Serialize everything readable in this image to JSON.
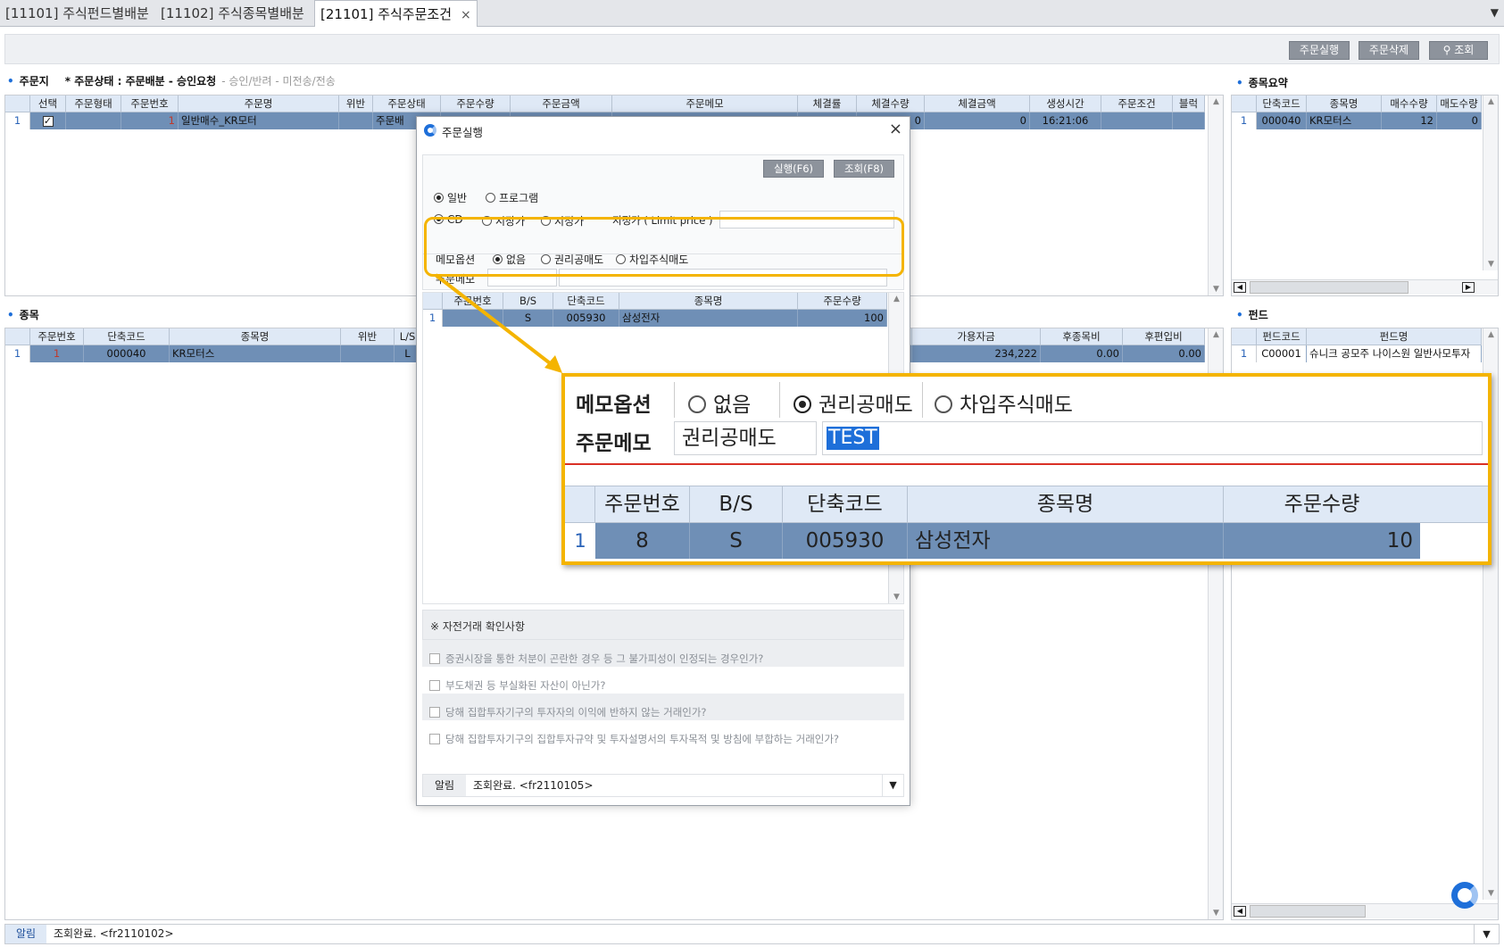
{
  "tabs": [
    {
      "label": "[11101] 주식펀드별배분"
    },
    {
      "label": "[11102] 주식종목별배분"
    },
    {
      "label": "[21101] 주식주문조건",
      "close": "×"
    }
  ],
  "tab_menu": "▼",
  "toolbar": {
    "execute": "주문실행",
    "delete": "주문삭제",
    "search": "조회",
    "search_icon": "search-icon"
  },
  "order_section": {
    "title": "주문지",
    "status_label": "* 주문상태 : 주문배분 - 승인요청",
    "status_sub": "- 승인/반려 - 미전송/전송"
  },
  "order_grid": {
    "columns": [
      "선택",
      "주문형태",
      "주문번호",
      "주문명",
      "위반",
      "주문상태",
      "주문수량",
      "주문금액",
      "주문메모",
      "체결률",
      "체결수량",
      "체결금액",
      "생성시간",
      "주문조건",
      "블럭"
    ],
    "rows": [
      {
        "row_num": "1",
        "checked": true,
        "order_no": "1",
        "order_name": "일반매수_KR모터",
        "status": "주문배",
        "filled_qty": "0",
        "filled_amt": "0",
        "created": "16:21:06"
      }
    ]
  },
  "summary_section": {
    "title": "종목요약"
  },
  "summary_grid": {
    "columns": [
      "단축코드",
      "종목명",
      "매수수량",
      "매도수량"
    ],
    "rows": [
      {
        "row_num": "1",
        "code": "000040",
        "name": "KR모터스",
        "buy_qty": "12",
        "sell_qty": "0"
      }
    ]
  },
  "item_section": {
    "title": "종목"
  },
  "item_grid": {
    "columns": [
      "주문번호",
      "단축코드",
      "종목명",
      "위반",
      "L/S"
    ],
    "right_columns": [
      "가용자금",
      "후종목비",
      "후편입비"
    ],
    "rows": [
      {
        "row_num": "1",
        "order_no": "1",
        "code": "000040",
        "name": "KR모터스",
        "ls": "L",
        "funds": "234,222",
        "ratio1": "0.00",
        "ratio2": "0.00"
      }
    ]
  },
  "fund_section": {
    "title": "펀드"
  },
  "fund_grid": {
    "columns": [
      "펀드코드",
      "펀드명"
    ],
    "rows": [
      {
        "row_num": "1",
        "code": "C00001",
        "name": "슈니크 공모주 나이스원 일반사모투자"
      }
    ]
  },
  "status_bar": {
    "label": "알림",
    "message": "조회완료. <fr2110102>",
    "dropdown": "▼"
  },
  "dialog": {
    "title": "주문실행",
    "close": "×",
    "execute_btn": "실행(F6)",
    "search_btn": "조회(F8)",
    "type_options": [
      "일반",
      "프로그램"
    ],
    "type_selected": "일반",
    "price_options": [
      "CD",
      "시장가",
      "지정가"
    ],
    "price_selected": "CD",
    "limit_label": "지정가 ( Limit price )",
    "memo_option_label": "메모옵션",
    "memo_options": [
      "없음",
      "권리공매도",
      "차입주식매도"
    ],
    "memo_selected": "없음",
    "memo_label": "주문메모",
    "grid": {
      "columns": [
        "주문번호",
        "B/S",
        "단축코드",
        "종목명",
        "주문수량"
      ],
      "rows": [
        {
          "row_num": "1",
          "order_no": "",
          "bs": "S",
          "code": "005930",
          "name": "삼성전자",
          "qty": "100"
        }
      ]
    },
    "checklist_title": "※ 자전거래 확인사항",
    "checklist": [
      "증권시장을 통한 처분이 곤란한 경우 등 그 불가피성이 인정되는 경우인가?",
      "부도채권 등 부실화된 자산이 아닌가?",
      "당해 집합투자기구의 투자자의 이익에 반하지 않는 거래인가?",
      "당해 집합투자기구의 집합투자규약 및 투자설명서의 투자목적 및 방침에 부합하는 거래인가?"
    ],
    "status_label": "알림",
    "status_message": "조회완료. <fr2110105>",
    "status_dropdown": "▼"
  },
  "zoom": {
    "memo_option_label": "메모옵션",
    "memo_options": [
      "없음",
      "권리공매도",
      "차입주식매도"
    ],
    "memo_selected": "권리공매도",
    "memo_label": "주문메모",
    "memo_value": "권리공매도",
    "memo_text": "TEST",
    "grid": {
      "columns": [
        "주문번호",
        "B/S",
        "단축코드",
        "종목명",
        "주문수량"
      ],
      "rows": [
        {
          "row_num": "1",
          "order_no": "8",
          "bs": "S",
          "code": "005930",
          "name": "삼성전자",
          "qty": "10"
        }
      ]
    }
  },
  "colors": {
    "highlight": "#f4b400",
    "selected_row": "#6f8fb6",
    "header": "#dfe9f6",
    "accent": "#1e6fd9"
  }
}
